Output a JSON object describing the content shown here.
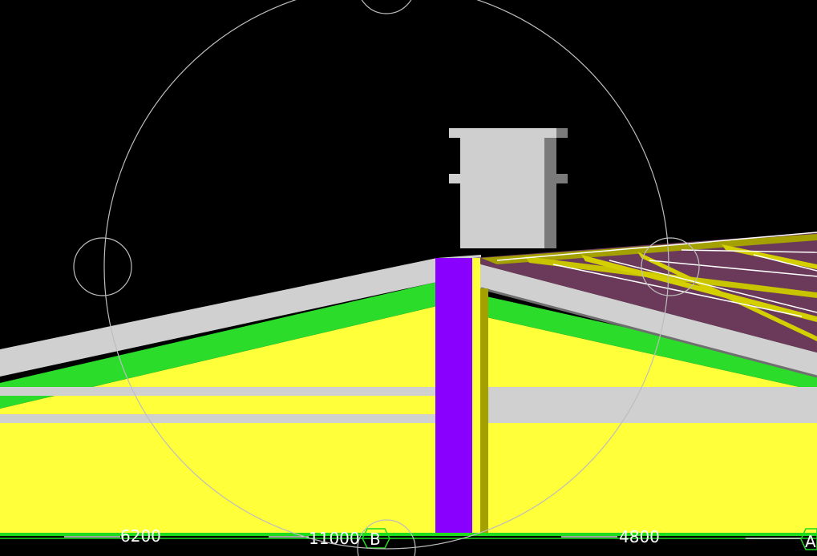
{
  "viewport": {
    "background": "#000000",
    "colors": {
      "wall": "#ffff3a",
      "flashing": "#2bdc2b",
      "steel": "#d0d0d0",
      "steel_shade": "#6f6f6f",
      "column": "#8a00ff",
      "roof_sheet": "#6b3a5a",
      "purlin": "#a4a000",
      "orbit_circle": "#bdbdbd",
      "gridline": "#1fdc1f"
    }
  },
  "navigation": {
    "orbit_ring": "orbit-ring",
    "handles": [
      "orbit-handle-top",
      "orbit-handle-left",
      "orbit-handle-right",
      "orbit-handle-bottom"
    ]
  },
  "dimensions": [
    {
      "id": "dim-left",
      "text": "6200"
    },
    {
      "id": "dim-middle",
      "text": "11000"
    },
    {
      "id": "dim-right",
      "text": "4800"
    }
  ],
  "grid_bubbles": [
    {
      "id": "grid-b",
      "label": "B"
    },
    {
      "id": "grid-a",
      "label": "A"
    }
  ]
}
